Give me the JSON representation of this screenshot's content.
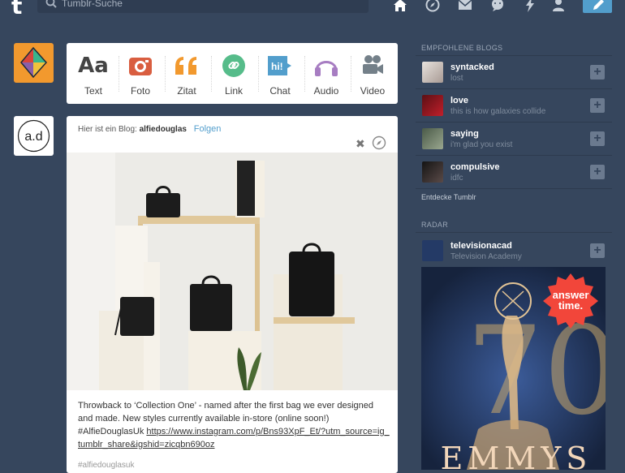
{
  "nav": {
    "logo": "t",
    "search_placeholder": "Tumblr-Suche",
    "icons": [
      "home-icon",
      "explore-icon",
      "inbox-icon",
      "messaging-icon",
      "activity-icon",
      "account-icon"
    ],
    "compose_icon": "pencil-icon",
    "accent": "#529ecc"
  },
  "post_types": [
    {
      "label": "Text",
      "icon": "Aa",
      "color": "#444444"
    },
    {
      "label": "Foto",
      "icon": "camera-icon",
      "color": "#d95e40"
    },
    {
      "label": "Zitat",
      "icon": "quote-icon",
      "color": "#f2992e"
    },
    {
      "label": "Link",
      "icon": "link-icon",
      "color": "#56bc8a"
    },
    {
      "label": "Chat",
      "icon": "hi!",
      "color": "#529ecc"
    },
    {
      "label": "Audio",
      "icon": "headphones-icon",
      "color": "#a77dc2"
    },
    {
      "label": "Video",
      "icon": "video-camera-icon",
      "color": "#748089"
    }
  ],
  "post": {
    "prefix": "Hier ist ein Blog:",
    "blog": "alfiedouglas",
    "follow": "Folgen",
    "avatar_text": "a.d",
    "caption_text": "Throwback to ‘Collection One’ - named after the first bag we ever designed and made. New styles currently available in-store (online soon!) #AlfieDouglasUk",
    "caption_link": "https://www.instagram.com/p/Bns93XpF_Et/?utm_source=ig_tumblr_share&igshid=zicqbn690oz",
    "tag": "#alfiedouglasuk"
  },
  "sidebar": {
    "recommended_title": "EMPFOHLENE BLOGS",
    "blogs": [
      {
        "name": "syntacked",
        "sub": "lost"
      },
      {
        "name": "love",
        "sub": "this is how galaxies collide"
      },
      {
        "name": "saying",
        "sub": "i'm glad you exist"
      },
      {
        "name": "compulsive",
        "sub": "idfc"
      }
    ],
    "discover": "Entdecke Tumblr",
    "radar_title": "RADAR",
    "radar": {
      "name": "televisionacad",
      "sub": "Television Academy"
    },
    "badge_line1": "answer",
    "badge_line2": "time.",
    "poster_big": "70",
    "poster_word": "EMMYS"
  }
}
